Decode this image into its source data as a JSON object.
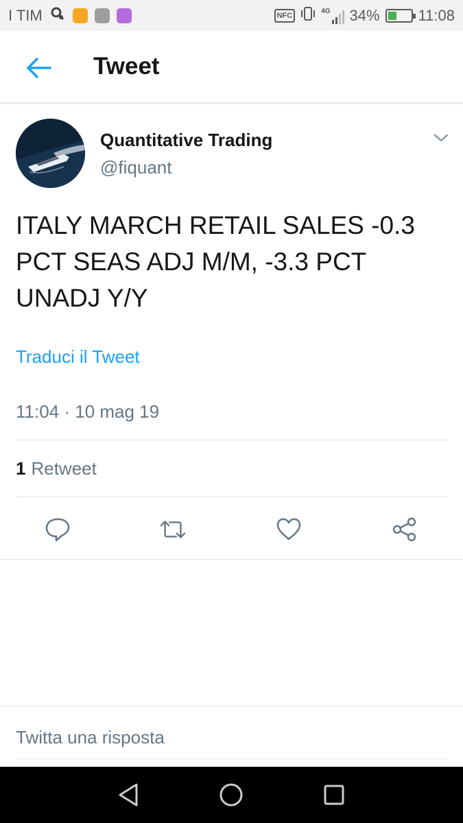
{
  "status_bar": {
    "carrier": "I TIM",
    "nfc": "NFC",
    "network": "4G",
    "battery_percent": "34%",
    "battery_level": 0.34,
    "time": "11:08",
    "app_icons": [
      "search-app-icon",
      "lock-app-icon",
      "gallery-app-icon",
      "keyboard-app-icon"
    ]
  },
  "header": {
    "title": "Tweet",
    "back_icon": "arrow-left-icon",
    "accent_color": "#1da1f2"
  },
  "tweet": {
    "author_name": "Quantitative Trading",
    "author_handle": "@fiquant",
    "text": "ITALY MARCH RETAIL SALES -0.3 PCT SEAS ADJ M/M, -3.3 PCT UNADJ Y/Y",
    "translate_label": "Traduci il Tweet",
    "timestamp": "11:04 · 10 mag 19",
    "retweet_count": "1",
    "retweet_label": "Retweet"
  },
  "actions": [
    {
      "name": "reply",
      "icon": "speech-bubble-icon"
    },
    {
      "name": "retweet",
      "icon": "retweet-icon"
    },
    {
      "name": "like",
      "icon": "heart-icon"
    },
    {
      "name": "share",
      "icon": "share-icon"
    }
  ],
  "reply": {
    "placeholder": "Twitta una risposta"
  },
  "nav_bar": {
    "buttons": [
      "back-triangle-icon",
      "home-circle-icon",
      "recents-square-icon"
    ]
  }
}
